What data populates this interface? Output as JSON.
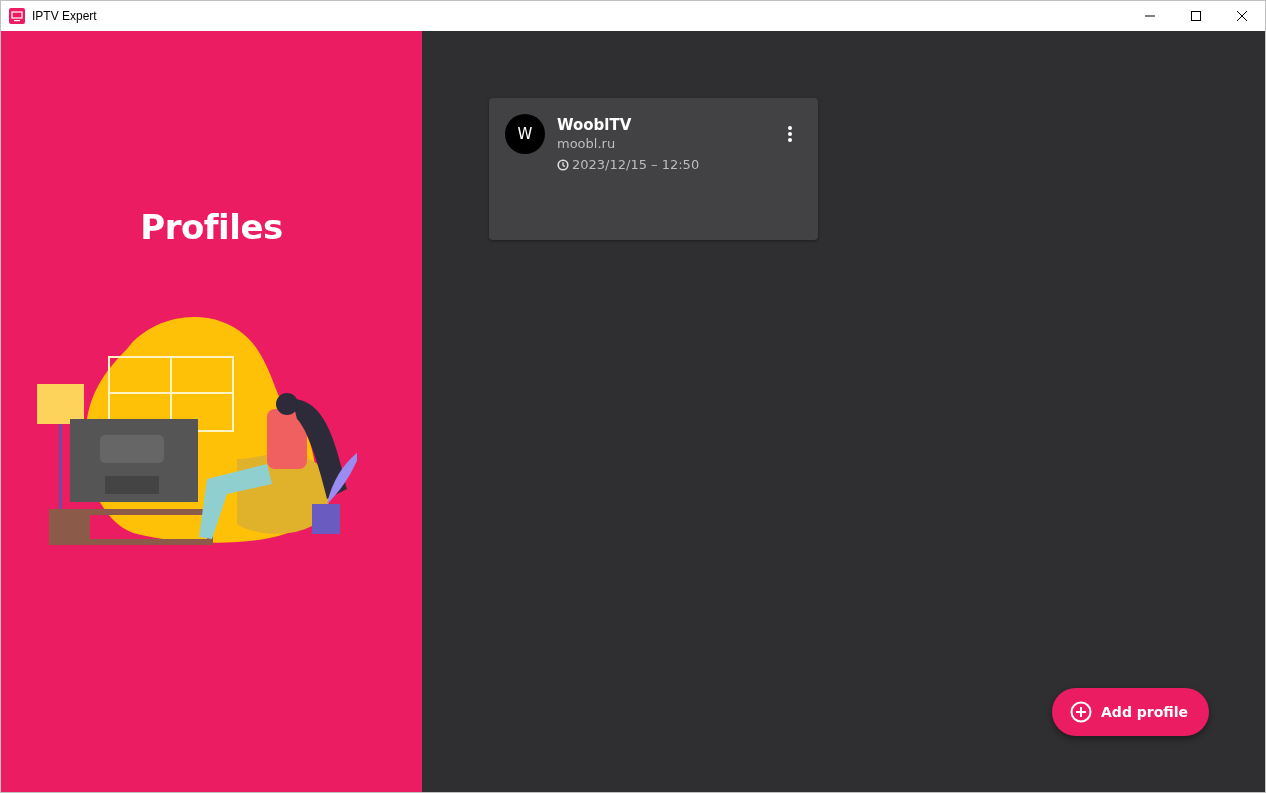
{
  "window": {
    "title": "IPTV Expert"
  },
  "hero": {
    "title": "Profiles"
  },
  "profiles": [
    {
      "initial": "W",
      "name": "WooblTV",
      "host": "moobl.ru",
      "updated": "2023/12/15 – 12:50"
    }
  ],
  "add_button": {
    "label": "Add profile"
  }
}
